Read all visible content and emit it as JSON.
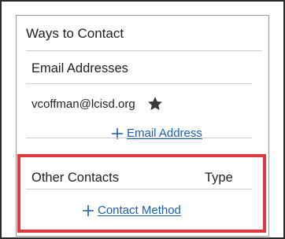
{
  "panel": {
    "title": "Ways to Contact"
  },
  "email_section": {
    "heading": "Email Addresses",
    "emails": [
      {
        "address": "vcoffman@lcisd.org",
        "primary_icon": "star-icon"
      }
    ],
    "add_label": "Email Address"
  },
  "other_contacts": {
    "heading": "Other Contacts",
    "type_heading": "Type",
    "add_label": "Contact Method"
  },
  "colors": {
    "link": "#1a5fb4",
    "highlight_border": "#e23a3a"
  }
}
